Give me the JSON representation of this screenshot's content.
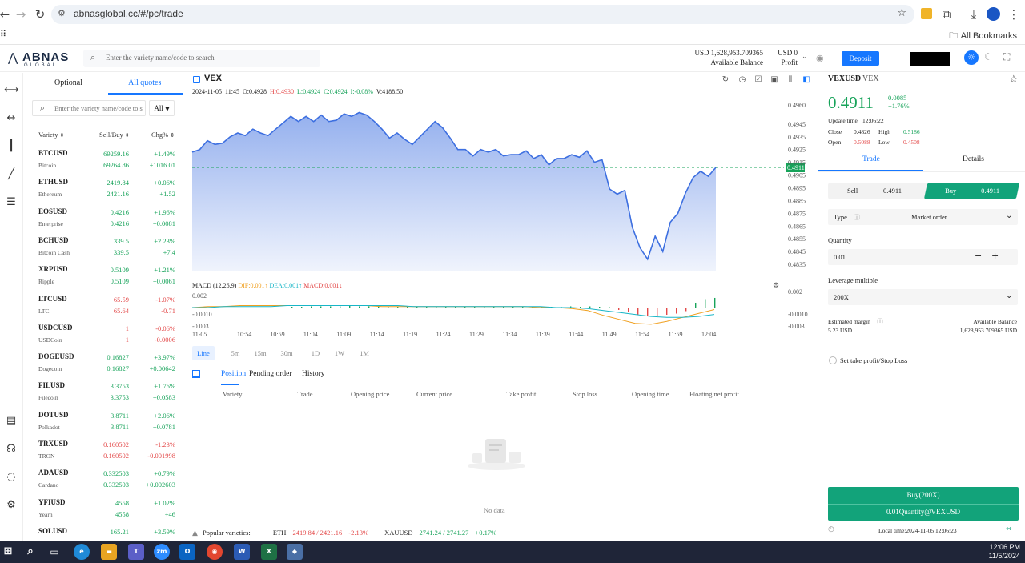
{
  "browser": {
    "url": "abnasglobal.cc/#/pc/trade",
    "bookmarks_label": "All Bookmarks"
  },
  "header": {
    "logo": "ABNAS",
    "logo_sub": "GLOBAL",
    "search_placeholder": "Enter the variety name/code to search",
    "balance_value": "USD 1,628,953.709365",
    "balance_label": "Available Balance",
    "profit_value": "USD 0",
    "profit_label": "Profit",
    "deposit_label": "Deposit"
  },
  "quotes": {
    "tab_optional": "Optional",
    "tab_all": "All quotes",
    "search_placeholder": "Enter the variety name/code to s",
    "filter": "All",
    "col_variety": "Variety",
    "col_sellbuy": "Sell/Buy",
    "col_chg": "Chg%",
    "items": [
      {
        "symbol": "BTCUSD",
        "name": "Bitcoin",
        "sell": "69259.16",
        "buy": "69264.86",
        "pct": "+1.49%",
        "chg": "+1016.01",
        "up": true
      },
      {
        "symbol": "ETHUSD",
        "name": "Ethereum",
        "sell": "2419.84",
        "buy": "2421.16",
        "pct": "+0.06%",
        "chg": "+1.52",
        "up": true
      },
      {
        "symbol": "EOSUSD",
        "name": "Enterprise",
        "sell": "0.4216",
        "buy": "0.4216",
        "pct": "+1.96%",
        "chg": "+0.0081",
        "up": true
      },
      {
        "symbol": "BCHUSD",
        "name": "Bitcoin Cash",
        "sell": "339.5",
        "buy": "339.5",
        "pct": "+2.23%",
        "chg": "+7.4",
        "up": true
      },
      {
        "symbol": "XRPUSD",
        "name": "Ripple",
        "sell": "0.5109",
        "buy": "0.5109",
        "pct": "+1.21%",
        "chg": "+0.0061",
        "up": true
      },
      {
        "symbol": "LTCUSD",
        "name": "LTC",
        "sell": "65.59",
        "buy": "65.64",
        "pct": "-1.07%",
        "chg": "-0.71",
        "up": false
      },
      {
        "symbol": "USDCUSD",
        "name": "USDCoin",
        "sell": "1",
        "buy": "1",
        "pct": "-0.06%",
        "chg": "-0.0006",
        "up": false
      },
      {
        "symbol": "DOGEUSD",
        "name": "Dogecoin",
        "sell": "0.16827",
        "buy": "0.16827",
        "pct": "+3.97%",
        "chg": "+0.00642",
        "up": true
      },
      {
        "symbol": "FILUSD",
        "name": "Filecoin",
        "sell": "3.3753",
        "buy": "3.3753",
        "pct": "+1.76%",
        "chg": "+0.0583",
        "up": true
      },
      {
        "symbol": "DOTUSD",
        "name": "Polkadot",
        "sell": "3.8711",
        "buy": "3.8711",
        "pct": "+2.06%",
        "chg": "+0.0781",
        "up": true
      },
      {
        "symbol": "TRXUSD",
        "name": "TRON",
        "sell": "0.160502",
        "buy": "0.160502",
        "pct": "-1.23%",
        "chg": "-0.001998",
        "up": false
      },
      {
        "symbol": "ADAUSD",
        "name": "Cardano",
        "sell": "0.332503",
        "buy": "0.332503",
        "pct": "+0.79%",
        "chg": "+0.002603",
        "up": true
      },
      {
        "symbol": "YFIUSD",
        "name": "Yearn",
        "sell": "4558",
        "buy": "4558",
        "pct": "+1.02%",
        "chg": "+46",
        "up": true
      },
      {
        "symbol": "SOLUSD",
        "name": "",
        "sell": "165.21",
        "buy": "",
        "pct": "+3.59%",
        "chg": "",
        "up": true
      }
    ]
  },
  "chart": {
    "symbol": "VEX",
    "date": "2024-11-05",
    "time": "11:45",
    "o_label": "O:",
    "o": "0.4928",
    "h_label": "H:",
    "h": "0.4930",
    "l_label": "L:",
    "l": "0.4924",
    "c_label": "C:",
    "c": "0.4924",
    "i_label": "I:",
    "i": "-0.08%",
    "v_label": "V:",
    "v": "4188.50",
    "current_tag": "0.4911",
    "macd_label": "MACD (12,26,9)",
    "dif": "DIF:0.001",
    "dea": "DEA:0.001",
    "macd": "MACD:0.001",
    "intervals": [
      "Line",
      "5m",
      "15m",
      "30m",
      "1D",
      "1W",
      "1M"
    ],
    "active_interval": "Line"
  },
  "chart_data": {
    "type": "area",
    "yticks": [
      "0.4960",
      "0.4945",
      "0.4935",
      "0.4925",
      "0.4915",
      "0.4905",
      "0.4895",
      "0.4885",
      "0.4875",
      "0.4865",
      "0.4855",
      "0.4845",
      "0.4835"
    ],
    "xticks": [
      "11-05",
      "10:54",
      "10:59",
      "11:04",
      "11:09",
      "11:14",
      "11:19",
      "11:24",
      "11:29",
      "11:34",
      "11:39",
      "11:44",
      "11:49",
      "11:54",
      "11:59",
      "12:04"
    ],
    "macd_yticks": [
      "0.002",
      "-0.0010",
      "-0.003",
      "0.002",
      "-0.0010",
      "-0.003"
    ],
    "ylim": [
      0.483,
      0.4965
    ],
    "series": [
      {
        "values": [
          0.4923,
          0.4925,
          0.4932,
          0.4929,
          0.493,
          0.4935,
          0.4938,
          0.4936,
          0.4941,
          0.4938,
          0.4936,
          0.4941,
          0.4946,
          0.4951,
          0.4947,
          0.4951,
          0.4947,
          0.4952,
          0.4947,
          0.4948,
          0.4953,
          0.4951,
          0.4954,
          0.4952,
          0.4947,
          0.4941,
          0.4934,
          0.4938,
          0.4933,
          0.4929,
          0.4935,
          0.4941,
          0.4947,
          0.4942,
          0.4934,
          0.4925,
          0.4925,
          0.492,
          0.4925,
          0.4923,
          0.4925,
          0.492,
          0.4921,
          0.4921,
          0.4924,
          0.4918,
          0.4921,
          0.4913,
          0.4918,
          0.4918,
          0.4921,
          0.4919,
          0.4924,
          0.4915,
          0.4917,
          0.4894,
          0.489,
          0.4893,
          0.4864,
          0.4848,
          0.4839,
          0.4857,
          0.4845,
          0.4868,
          0.4875,
          0.4891,
          0.4903,
          0.4908,
          0.4904,
          0.4911
        ]
      }
    ],
    "macd_hist": [
      0.0,
      0.0,
      0.0001,
      0.0001,
      0.0001,
      0.0001,
      0.0002,
      0.0001,
      0.0001,
      0.0001,
      0.0001,
      0.0,
      0.0001,
      0.0001,
      0.0001,
      0.0001,
      0.0,
      0.0001,
      0.0001,
      0.0,
      0.0,
      0.0001,
      0.0,
      0.0001,
      0.0001,
      0.0,
      0.0,
      0.0,
      0.0,
      0.0001,
      0.0,
      0.0001,
      0.0,
      0.0,
      -0.0002,
      -0.0004,
      -0.0006,
      -0.0007,
      -0.0007,
      -0.0006,
      -0.0005,
      -0.0003,
      0.0004,
      0.0007,
      0.0008
    ],
    "dif": [
      0.0,
      0.0001,
      0.0001,
      0.0002,
      0.0002,
      0.0002,
      0.0002,
      0.0002,
      0.0002,
      0.0002,
      0.0002,
      0.0002,
      0.0001,
      0.0001,
      0.0001,
      0.0001,
      0.0001,
      0.0001,
      0.0001,
      0.0001,
      0.0001,
      0.0001,
      0.0,
      0.0,
      -0.0001,
      -0.0003,
      -0.0008,
      -0.0012,
      -0.0016,
      -0.0017,
      -0.0014,
      -0.001,
      -0.0006,
      -0.0002
    ],
    "dea": [
      0.0,
      0.0,
      0.0001,
      0.0001,
      0.0001,
      0.0001,
      0.0002,
      0.0002,
      0.0002,
      0.0002,
      0.0002,
      0.0002,
      0.0002,
      0.0002,
      0.0001,
      0.0001,
      0.0001,
      0.0001,
      0.0001,
      0.0001,
      0.0001,
      0.0001,
      0.0001,
      0.0,
      0.0,
      -0.0001,
      -0.0003,
      -0.0005,
      -0.0007,
      -0.0009,
      -0.001,
      -0.001,
      -0.0009,
      -0.0007
    ]
  },
  "positions": {
    "tabs": [
      "Position",
      "Pending order",
      "History"
    ],
    "columns": [
      "Variety",
      "Trade",
      "Opening price",
      "Current price",
      "Take profit",
      "Stop loss",
      "Opening time",
      "Floating net profit"
    ],
    "empty": "No data",
    "popular_label": "Popular varieties:",
    "popular": [
      {
        "sym": "ETH",
        "price": "2419.84 / 2421.16",
        "pct": "-2.13%",
        "up": false
      },
      {
        "sym": "XAUUSD",
        "price": "2741.24 / 2741.27",
        "pct": "+0.17%",
        "up": true
      }
    ]
  },
  "panel": {
    "symbol": "VEXUSD",
    "sub": "VEX",
    "price": "0.4911",
    "change": "0.0085",
    "change_pct": "+1.76%",
    "update_label": "Update time",
    "update_time": "12:06:22",
    "close_label": "Close",
    "close": "0.4826",
    "high_label": "High",
    "high": "0.5186",
    "open_label": "Open",
    "open": "0.5088",
    "low_label": "Low",
    "low": "0.4508",
    "tab_trade": "Trade",
    "tab_details": "Details",
    "sell_label": "Sell",
    "sell_price": "0.4911",
    "buy_label": "Buy",
    "buy_price": "0.4911",
    "type_label": "Type",
    "type_value": "Market order",
    "quantity_label": "Quantity",
    "quantity": "0.01",
    "leverage_label": "Leverage multiple",
    "leverage": "200X",
    "margin_label": "Estimated margin",
    "margin": "5.23 USD",
    "avail_label": "Available Balance",
    "avail": "1,628,953.709365 USD",
    "tpsl_label": "Set take profit/Stop Loss",
    "buy_btn_line1": "Buy(200X)",
    "buy_btn_line2": "0.01Quantity@VEXUSD",
    "local_time": "Local time:2024-11-05 12:06:23"
  },
  "taskbar": {
    "time": "12:06 PM",
    "date": "11/5/2024"
  },
  "colors": {
    "accent": "#1677ff",
    "green": "#17a35a",
    "red": "#e34848",
    "line": "#3d6fe0",
    "buy_btn": "#12a37a"
  }
}
